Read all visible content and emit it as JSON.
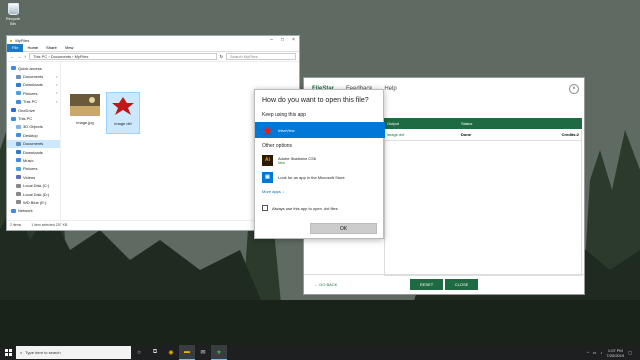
{
  "desktop": {
    "recycle_bin_label": "Recycle Bin"
  },
  "explorer": {
    "title": "MyFiles",
    "ribbon_tabs": [
      "File",
      "Home",
      "Share",
      "View"
    ],
    "address": {
      "seg1": "This PC",
      "seg2": "Documents",
      "seg3": "MyFiles"
    },
    "search_placeholder": "Search MyFiles",
    "sidebar": [
      {
        "label": "Quick access",
        "sub": false,
        "color": "#3a8ee6"
      },
      {
        "label": "Documents",
        "sub": true,
        "color": "#6a8fb5"
      },
      {
        "label": "Downloads",
        "sub": true,
        "color": "#2c7bd1"
      },
      {
        "label": "Pictures",
        "sub": true,
        "color": "#4aa3df"
      },
      {
        "label": "This PC",
        "sub": true,
        "color": "#3a8ee6"
      },
      {
        "label": "OneDrive",
        "sub": false,
        "color": "#2a6bd8"
      },
      {
        "label": "This PC",
        "sub": false,
        "color": "#3a8ee6"
      },
      {
        "label": "3D Objects",
        "sub": true,
        "color": "#7cb4e6"
      },
      {
        "label": "Desktop",
        "sub": true,
        "color": "#3a8ee6"
      },
      {
        "label": "Documents",
        "sub": true,
        "color": "#6a8fb5",
        "selected": true
      },
      {
        "label": "Downloads",
        "sub": true,
        "color": "#2c7bd1"
      },
      {
        "label": "Music",
        "sub": true,
        "color": "#3a8ee6"
      },
      {
        "label": "Pictures",
        "sub": true,
        "color": "#4aa3df"
      },
      {
        "label": "Videos",
        "sub": true,
        "color": "#5a6fc0"
      },
      {
        "label": "Local Disk (C:)",
        "sub": true,
        "color": "#888"
      },
      {
        "label": "Local Disk (D:)",
        "sub": true,
        "color": "#888"
      },
      {
        "label": "WD Blue (E:)",
        "sub": true,
        "color": "#888"
      },
      {
        "label": "Network",
        "sub": false,
        "color": "#3a8ee6"
      }
    ],
    "files": [
      {
        "name": "image.jpg"
      },
      {
        "name": "image.dxf"
      }
    ],
    "status": {
      "count": "2 items",
      "selection": "1 item selected  257 KB"
    }
  },
  "filestar": {
    "logo": "FileStar",
    "nav": [
      "Feedback",
      "Help"
    ],
    "table": {
      "headers": [
        "Output",
        "Status"
      ],
      "row": {
        "output": "image.dxf",
        "status": "Done",
        "credits": "Credits:2"
      }
    },
    "go_back": "GO BACK",
    "reset": "RESET",
    "close": "CLOSE"
  },
  "dialog": {
    "title": "How do you want to open this file?",
    "keep_label": "Keep using this app",
    "current_app": "IrfanView",
    "other_label": "Other options",
    "apps": [
      {
        "name": "Adobe Illustrator CS6",
        "tag": "New"
      },
      {
        "name": "Look for an app in the Microsoft Store",
        "tag": ""
      }
    ],
    "more_apps": "More apps  ↓",
    "always_label": "Always use this app to open .dxf files",
    "ok": "OK"
  },
  "taskbar": {
    "search_placeholder": "Type here to search",
    "time": "1:07 PM",
    "date": "7/20/2019"
  }
}
